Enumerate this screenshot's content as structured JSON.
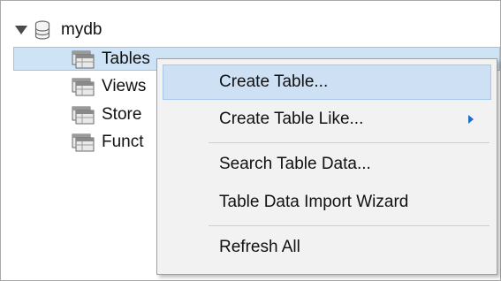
{
  "tree": {
    "database": {
      "name": "mydb",
      "icon": "database-icon"
    },
    "children": [
      {
        "label": "Tables",
        "icon": "table-folder-icon",
        "selected": true
      },
      {
        "label": "Views",
        "icon": "view-folder-icon"
      },
      {
        "label": "Store",
        "icon": "procedure-folder-icon"
      },
      {
        "label": "Funct",
        "icon": "function-folder-icon"
      }
    ]
  },
  "context_menu": {
    "items": [
      {
        "label": "Create Table...",
        "highlighted": true
      },
      {
        "label": "Create Table Like...",
        "has_submenu": true
      },
      {
        "label": "Search Table Data..."
      },
      {
        "label": "Table Data Import Wizard"
      },
      {
        "label": "Refresh All"
      }
    ]
  },
  "colors": {
    "selection": "#cfe3f6",
    "menu_highlight": "#cde0f4",
    "submenu_arrow": "#1e6ec8"
  }
}
